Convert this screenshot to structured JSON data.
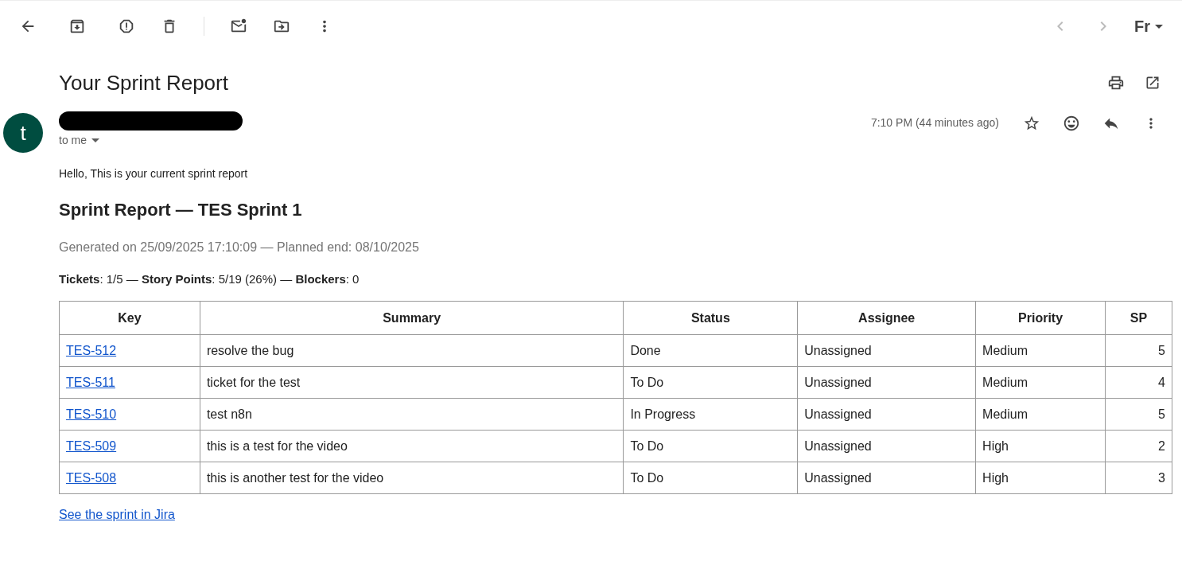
{
  "toolbar": {
    "language_button": "Fr"
  },
  "message": {
    "subject": "Your Sprint Report",
    "avatar_letter": "t",
    "recipient": "to me",
    "time": "7:10 PM (44 minutes ago)",
    "starred": false
  },
  "body": {
    "greeting": "Hello, This is your current sprint report",
    "heading": "Sprint Report — TES Sprint 1",
    "generated": "Generated on 25/09/2025 17:10:09 — Planned end: 08/10/2025",
    "summary": "**Tickets**: 1/5 — **Story Points**: 5/19 (26%) — **Blockers**: 0",
    "table": {
      "columns": [
        "Key",
        "Summary",
        "Status",
        "Assignee",
        "Priority",
        "SP"
      ],
      "rows": [
        [
          "TES-512",
          "resolve the bug",
          "Done",
          "Unassigned",
          "Medium",
          "5"
        ],
        [
          "TES-511",
          "ticket for the test",
          "To Do",
          "Unassigned",
          "Medium",
          "4"
        ],
        [
          "TES-510",
          "test n8n",
          "In Progress",
          "Unassigned",
          "Medium",
          "5"
        ],
        [
          "TES-509",
          "this is a test for the video",
          "To Do",
          "Unassigned",
          "High",
          "2"
        ],
        [
          "TES-508",
          "this is another test for the video",
          "To Do",
          "Unassigned",
          "High",
          "3"
        ]
      ]
    },
    "link": "See the sprint in Jira"
  }
}
